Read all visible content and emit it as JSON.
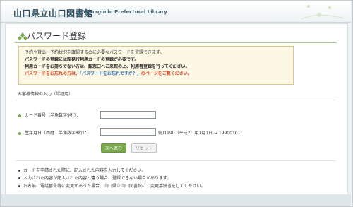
{
  "header": {
    "logo_jp": "山口県立山口図書館",
    "logo_en": "Yamaguchi Prefectural Library"
  },
  "page": {
    "title": "パスワード登録"
  },
  "notice": {
    "line1": "予約や貸出・予約状況を確認するのに必要なパスワードを登録できます。",
    "line2": "パスワードの登録には館発行利用カードの登録が必要です。",
    "line3": "利用カードをお持ちでない方は、館窓口へご来館の上、利用者登録を行ってください。",
    "line4_pre": "パスワードをお忘れの方は、",
    "line4_link": "「パスワードをお忘れですか？」",
    "line4_post": "のページをご覧ください。"
  },
  "form": {
    "section_label": "お客様情報の入力（認証用）",
    "card_label": "カード番号（半角数字9桁）：",
    "card_value": "",
    "birth_label": "生年月日（西暦　半角数字8桁）：",
    "birth_value": "",
    "birth_hint": "例)1990（平成2）年1月1日 → 19900101",
    "next_button": "次へ進む",
    "reset_button": "リセット"
  },
  "notes": [
    "カードを申請された際に、記入された内容を入力してください。",
    "入力された内容が記入された内容と違う場合、登録できない場合があります。",
    "お名前、電話番号等に変更があった場合、山口県立山口図書館にて変更手続きをしてください。"
  ],
  "colors": {
    "accent_green": "#7aa84c",
    "warning_red": "#e0401a",
    "link_blue": "#2a6fb8",
    "notice_bg": "#fdf8e6"
  }
}
